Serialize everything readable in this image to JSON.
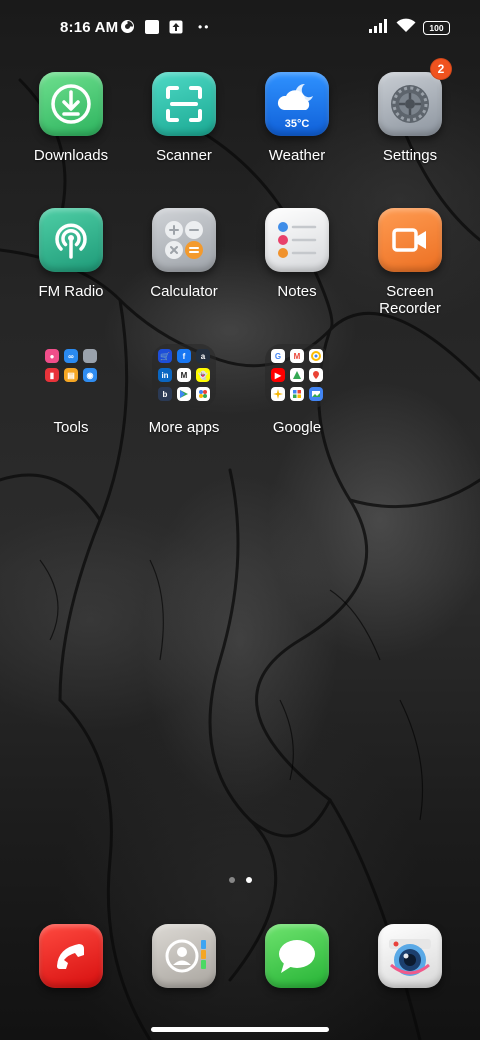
{
  "status_bar": {
    "time": "8:16 AM",
    "icons": [
      "data-saver-icon",
      "square-notification-icon",
      "upload-icon",
      "more-dots-icon"
    ],
    "signal": "signal-bars-icon",
    "wifi": "wifi-icon",
    "battery": "100"
  },
  "apps": [
    {
      "label": "Downloads",
      "icon": "download-icon",
      "color": "#3cc66f"
    },
    {
      "label": "Scanner",
      "icon": "scanner-icon",
      "color": "#27c4b0"
    },
    {
      "label": "Weather",
      "icon": "weather-icon",
      "color": "#1e7ff0",
      "temp": "35°C"
    },
    {
      "label": "Settings",
      "icon": "gear-icon",
      "color": "#9aa2ac",
      "badge": "2"
    },
    {
      "label": "FM Radio",
      "icon": "radio-icon",
      "color": "#2bb58f"
    },
    {
      "label": "Calculator",
      "icon": "calculator-icon",
      "color": "#a8adb3"
    },
    {
      "label": "Notes",
      "icon": "notes-icon",
      "color": "#e9eaec"
    },
    {
      "label": "Screen Recorder",
      "icon": "video-camera-icon",
      "color": "#f5853a"
    }
  ],
  "folders": [
    {
      "label": "Tools"
    },
    {
      "label": "More apps"
    },
    {
      "label": "Google"
    }
  ],
  "dock": [
    {
      "name": "phone",
      "icon": "phone-icon",
      "color": "#e8201e"
    },
    {
      "name": "contacts",
      "icon": "contacts-icon",
      "color": "#b9b6b1"
    },
    {
      "name": "messages",
      "icon": "message-icon",
      "color": "#3ccb4b"
    },
    {
      "name": "camera",
      "icon": "camera-icon",
      "color": "#f2f2f2"
    }
  ],
  "pages": {
    "count": 2,
    "current": 2
  }
}
